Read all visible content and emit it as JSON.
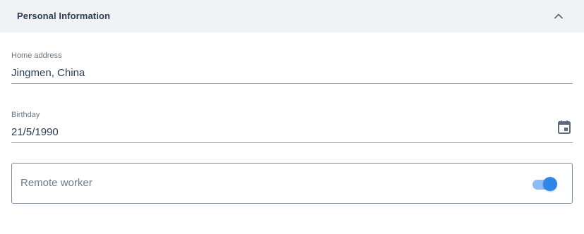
{
  "section": {
    "title": "Personal Information",
    "collapse_icon": "chevron-up-icon"
  },
  "home_address": {
    "label": "Home address",
    "value": "Jingmen, China"
  },
  "birthday": {
    "label": "Birthday",
    "value": "21/5/1990",
    "icon": "calendar-icon"
  },
  "remote_worker": {
    "label": "Remote worker",
    "checked": true
  },
  "colors": {
    "header_bg": "#f1f2f4",
    "title_text": "#2f3d52",
    "accent": "#2f86e8",
    "accent_light": "#8fbcf3",
    "field_line": "#9aa3ae"
  }
}
